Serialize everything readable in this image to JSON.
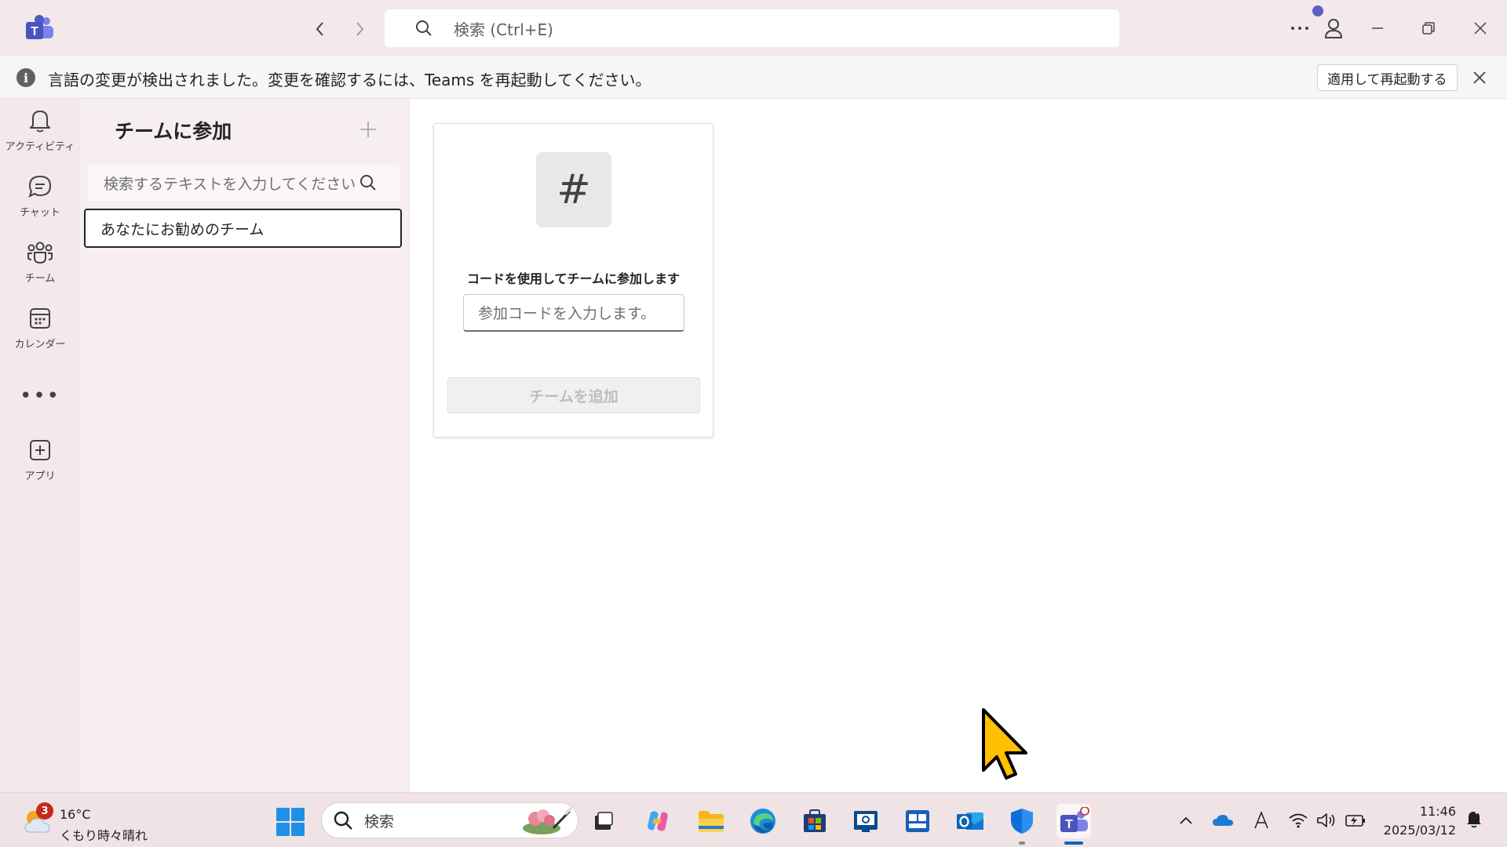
{
  "titlebar": {
    "search_placeholder": "検索 (Ctrl+E)"
  },
  "notification": {
    "message": "言語の変更が検出されました。変更を確認するには、Teams を再起動してください。",
    "apply_button": "適用して再起動する"
  },
  "rail": {
    "items": [
      {
        "label": "アクティビティ",
        "icon": "bell-icon"
      },
      {
        "label": "チャット",
        "icon": "chat-icon"
      },
      {
        "label": "チーム",
        "icon": "teams-icon"
      },
      {
        "label": "カレンダー",
        "icon": "calendar-icon"
      },
      {
        "label": "アプリ",
        "icon": "add-app-icon"
      }
    ],
    "more": "•••"
  },
  "pane": {
    "title": "チームに参加",
    "search_placeholder": "検索するテキストを入力してください",
    "selected_item": "あなたにお勧めのチーム"
  },
  "join_card": {
    "icon": "#",
    "label": "コードを使用してチームに参加します",
    "code_placeholder": "参加コードを入力します。",
    "add_button": "チームを追加"
  },
  "taskbar": {
    "weather": {
      "badge": "3",
      "temperature": "16°C",
      "condition": "くもり時々晴れ"
    },
    "search_label": "検索",
    "time": "11:46",
    "date": "2025/03/12",
    "apps": [
      "task-view",
      "copilot",
      "file-explorer",
      "edge",
      "store",
      "remote-app",
      "people-app",
      "outlook",
      "defender",
      "teams"
    ]
  },
  "colors": {
    "accent": "#5b5fc7",
    "titlebar_bg": "#f3e9ec",
    "main_bg": "#ffffff",
    "cursor": "#ffc000"
  }
}
